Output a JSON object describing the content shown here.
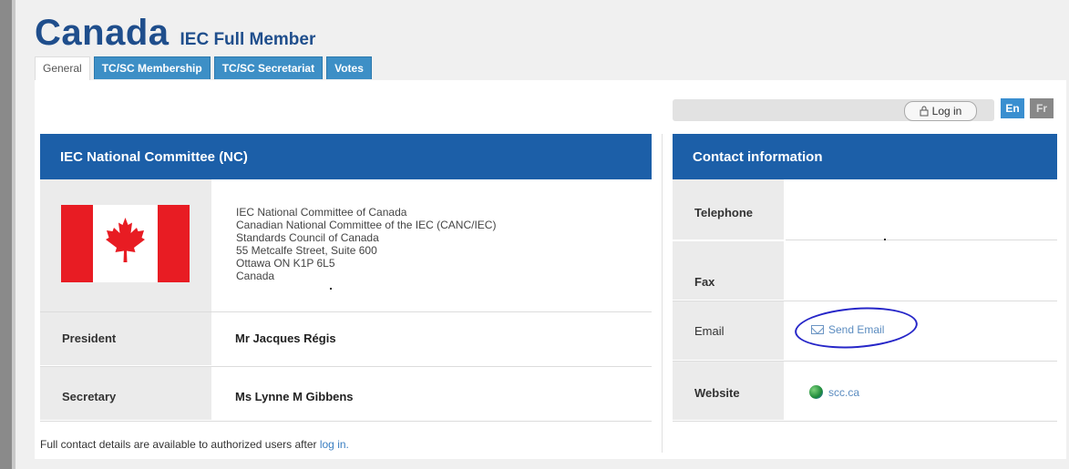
{
  "header": {
    "country": "Canada",
    "status": "IEC Full Member"
  },
  "tabs": [
    {
      "label": "General",
      "active": true
    },
    {
      "label": "TC/SC Membership",
      "active": false
    },
    {
      "label": "TC/SC Secretariat",
      "active": false
    },
    {
      "label": "Votes",
      "active": false
    }
  ],
  "topbar": {
    "login_label": "Log in",
    "lang_en": "En",
    "lang_fr": "Fr"
  },
  "national_committee": {
    "heading": "IEC National Committee (NC)",
    "address_lines": [
      "IEC National Committee of Canada",
      "Canadian National Committee of the IEC (CANC/IEC)",
      "Standards Council of Canada",
      "55 Metcalfe Street, Suite 600",
      "Ottawa ON K1P 6L5",
      "Canada"
    ],
    "president_label": "President",
    "president_value": "Mr Jacques Régis",
    "secretary_label": "Secretary",
    "secretary_value": "Ms Lynne M Gibbens"
  },
  "contact": {
    "heading": "Contact information",
    "telephone_label": "Telephone",
    "fax_label": "Fax",
    "email_label": "Email",
    "email_link": "Send Email",
    "website_label": "Website",
    "website_link": "scc.ca"
  },
  "footer": {
    "text": "Full contact details are available to authorized users after ",
    "link": "log in."
  },
  "colors": {
    "brand_blue": "#1c5fa8",
    "tab_blue": "#3d8fc6",
    "flag_red": "#e81c23",
    "annotation": "#2626c8"
  },
  "icons": [
    "lock-icon",
    "envelope-icon",
    "globe-icon",
    "maple-leaf-icon"
  ]
}
